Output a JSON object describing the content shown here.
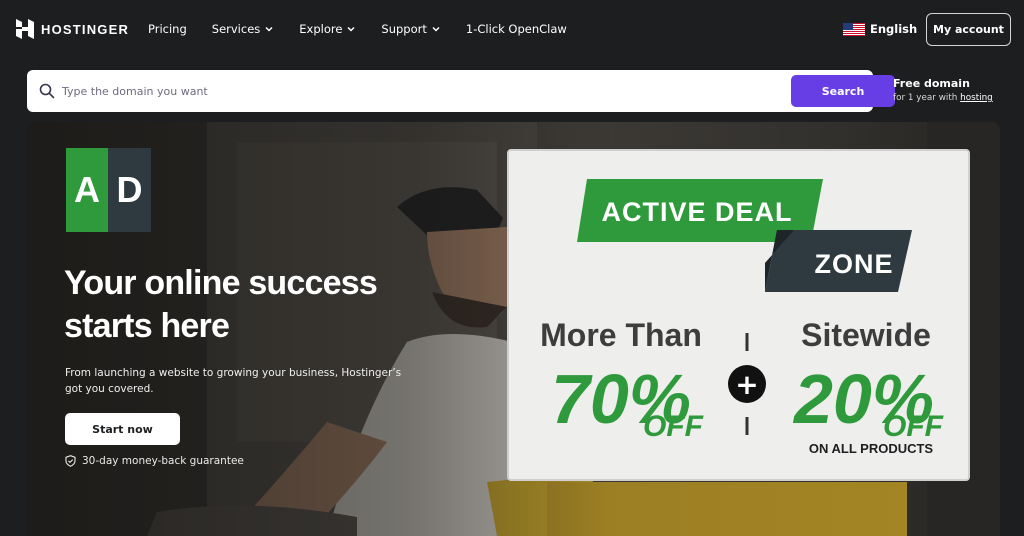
{
  "brand": {
    "name": "HOSTINGER"
  },
  "nav": {
    "items": [
      {
        "label": "Pricing",
        "dropdown": false
      },
      {
        "label": "Services",
        "dropdown": true
      },
      {
        "label": "Explore",
        "dropdown": true
      },
      {
        "label": "Support",
        "dropdown": true
      },
      {
        "label": "1-Click OpenClaw",
        "dropdown": false
      }
    ],
    "language": "English",
    "account_label": "My account"
  },
  "search": {
    "placeholder": "Type the domain you want",
    "value": "",
    "button_label": "Search"
  },
  "free_domain": {
    "title": "Free domain",
    "sub_prefix": "for 1 year with ",
    "sub_link": "hosting"
  },
  "hero": {
    "badge": {
      "left": "A",
      "right": "D"
    },
    "title": "Your online success starts here",
    "subtitle": "From launching a website to growing your business, Hostinger’s got you covered.",
    "cta_label": "Start now",
    "guarantee": "30-day money-back guarantee"
  },
  "deal": {
    "banner_line1": "ACTIVE DEAL",
    "banner_line2": "ZONE",
    "left_heading": "More Than",
    "left_value": "70%",
    "left_off": "OFF",
    "plus": "+",
    "right_heading": "Sitewide",
    "right_value": "20%",
    "right_off": "OFF",
    "right_note": "ON ALL PRODUCTS"
  },
  "colors": {
    "nav_bg": "#1d1e20",
    "brand_purple": "#673de6",
    "deal_green": "#2f9a3c",
    "deal_dark": "#2e3a3f",
    "deal_card_bg": "#eeeeec"
  },
  "icons": {
    "logo": "hostinger-logo-icon",
    "chevron": "chevron-down-icon",
    "flag": "us-flag-icon",
    "search": "search-icon",
    "guarantee": "shield-check-icon",
    "plus": "plus-icon"
  }
}
